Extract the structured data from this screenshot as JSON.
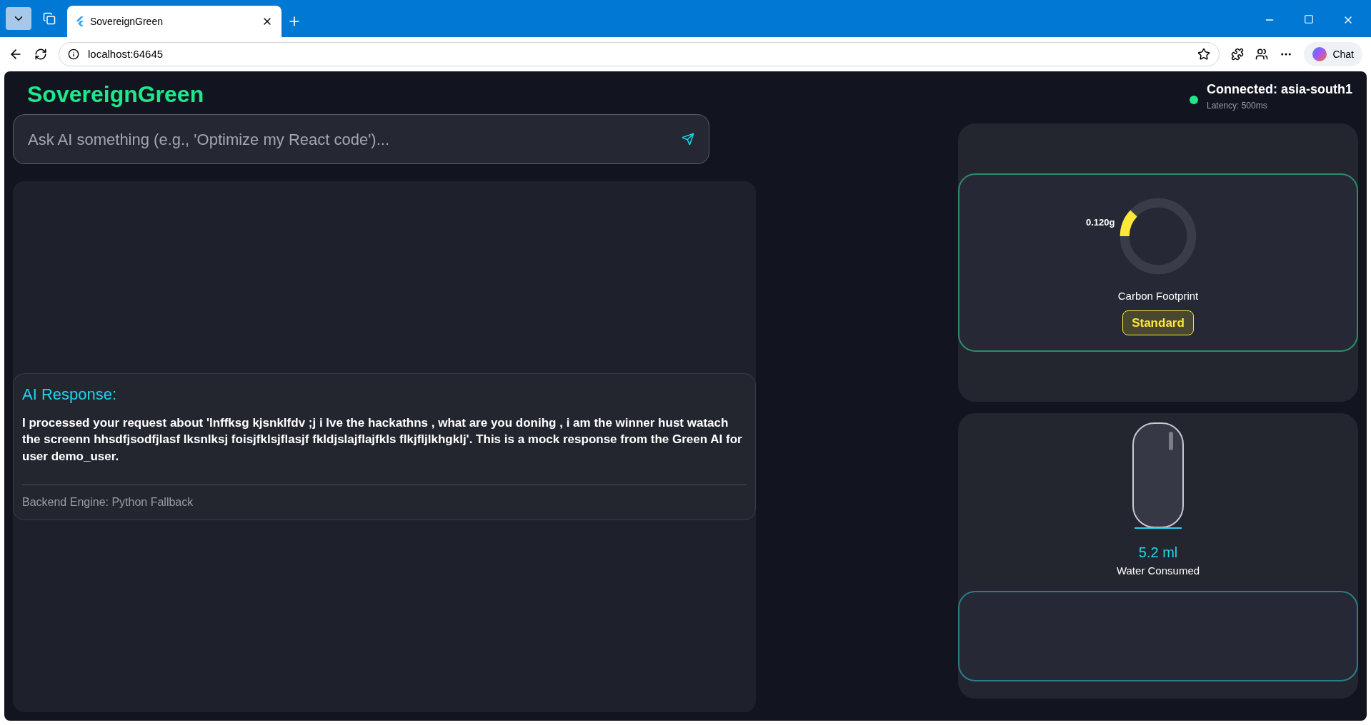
{
  "browser": {
    "tab_title": "SovereignGreen",
    "address": "localhost:64645",
    "chat_button": "Chat"
  },
  "app": {
    "title": "SovereignGreen",
    "prompt": {
      "placeholder": "Ask AI something (e.g., 'Optimize my React code')..."
    },
    "response": {
      "heading": "AI Response:",
      "text": "I processed your request about 'lnffksg kjsnklfdv ;j i lve the hackathns , what are you donihg , i am the winner hust watach the screenn hhsdfjsodfjlasf lksnlksj foisjfklsjflasjf fkldjslajflajfkls flkjfljlkhgklj'. This is a mock response from the Green AI for user demo_user.",
      "engine": "Backend Engine: Python Fallback"
    },
    "connection": {
      "status": "Connected: asia-south1",
      "latency": "Latency: 500ms",
      "online": true
    },
    "carbon": {
      "value": "0.120g",
      "level": 0.12,
      "label": "Carbon Footprint",
      "badge": "Standard"
    },
    "water": {
      "value": "5.2 ml",
      "label": "Water Consumed"
    }
  }
}
